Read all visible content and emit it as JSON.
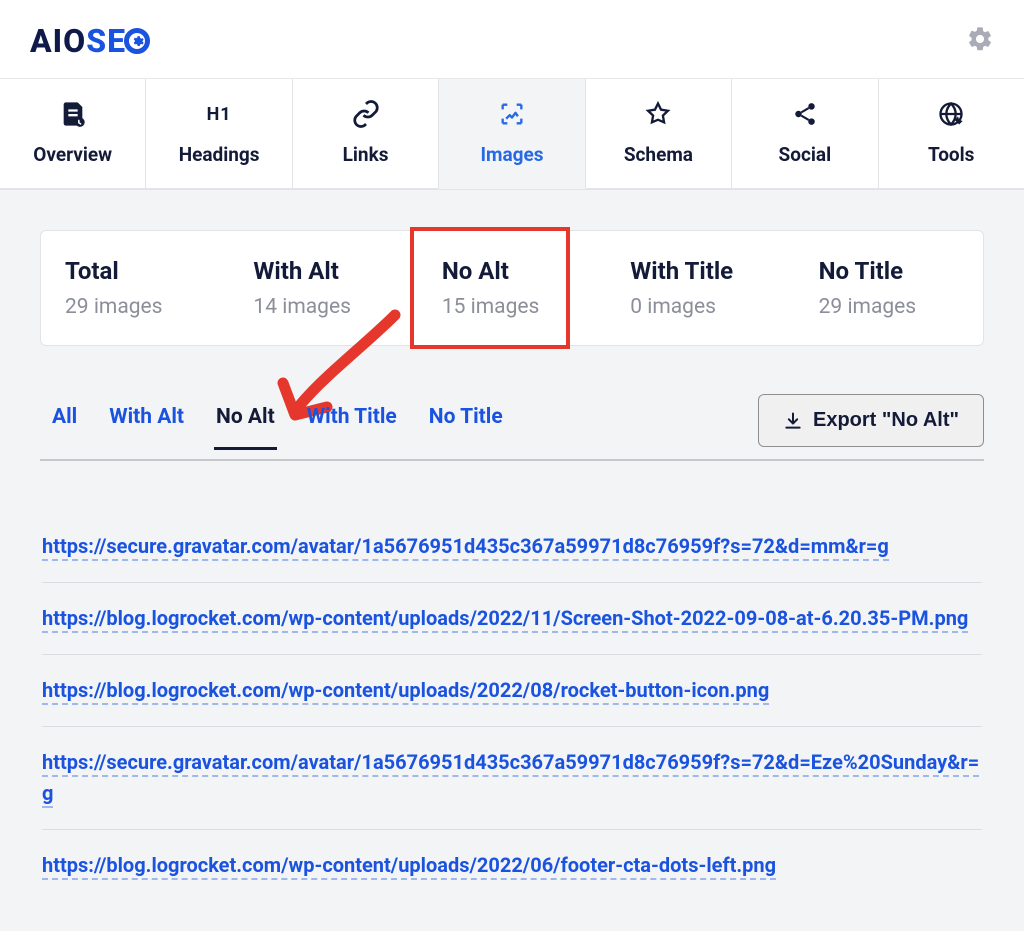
{
  "logo": {
    "part1": "AIO",
    "part2": "SE"
  },
  "tabs": [
    {
      "key": "overview",
      "label": "Overview"
    },
    {
      "key": "headings",
      "label": "Headings"
    },
    {
      "key": "links",
      "label": "Links"
    },
    {
      "key": "images",
      "label": "Images",
      "active": true
    },
    {
      "key": "schema",
      "label": "Schema"
    },
    {
      "key": "social",
      "label": "Social"
    },
    {
      "key": "tools",
      "label": "Tools"
    }
  ],
  "stats": {
    "total": {
      "title": "Total",
      "sub": "29 images"
    },
    "with_alt": {
      "title": "With Alt",
      "sub": "14 images"
    },
    "no_alt": {
      "title": "No Alt",
      "sub": "15 images"
    },
    "with_title": {
      "title": "With Title",
      "sub": "0 images"
    },
    "no_title": {
      "title": "No Title",
      "sub": "29 images"
    }
  },
  "filters": {
    "all": "All",
    "with_alt": "With Alt",
    "no_alt": "No Alt",
    "with_title": "With Title",
    "no_title": "No Title"
  },
  "export_label": "Export \"No Alt\"",
  "urls": [
    "https://secure.gravatar.com/avatar/1a5676951d435c367a59971d8c76959f?s=72&d=mm&r=g",
    "https://blog.logrocket.com/wp-content/uploads/2022/11/Screen-Shot-2022-09-08-at-6.20.35-PM.png",
    "https://blog.logrocket.com/wp-content/uploads/2022/08/rocket-button-icon.png",
    "https://secure.gravatar.com/avatar/1a5676951d435c367a59971d8c76959f?s=72&d=Eze%20Sunday&r=g",
    "https://blog.logrocket.com/wp-content/uploads/2022/06/footer-cta-dots-left.png"
  ]
}
